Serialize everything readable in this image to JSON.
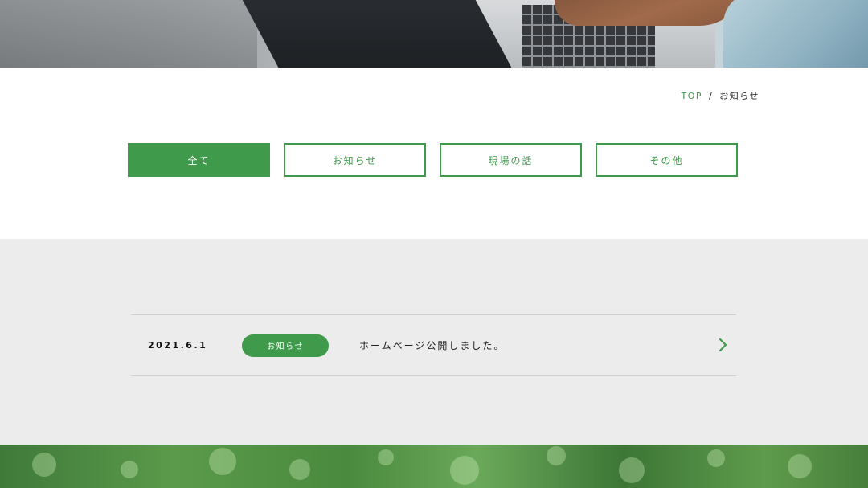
{
  "breadcrumb": {
    "home": "TOP",
    "separator": "/",
    "current": "お知らせ"
  },
  "tabs": [
    {
      "label": "全て",
      "active": true
    },
    {
      "label": "お知らせ",
      "active": false
    },
    {
      "label": "現場の話",
      "active": false
    },
    {
      "label": "その他",
      "active": false
    }
  ],
  "news": {
    "items": [
      {
        "date": "2021.6.1",
        "category": "お知らせ",
        "title": "ホームページ公開しました。",
        "arrow_icon": "chevron-right-icon"
      }
    ]
  },
  "colors": {
    "accent": "#3f9a4c",
    "section_bg": "#ececec",
    "text": "#222222"
  }
}
